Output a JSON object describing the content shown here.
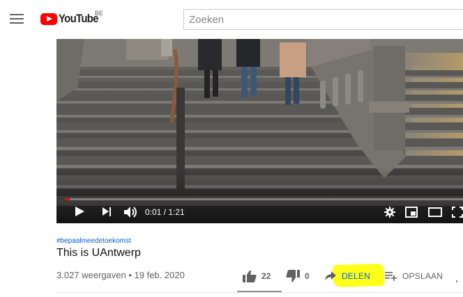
{
  "masthead": {
    "logo_text": "YouTube",
    "country_code": "BE",
    "search_placeholder": "Zoeken"
  },
  "player": {
    "time_display": "0:01 / 1:21",
    "progress_fraction": 0.012
  },
  "video": {
    "hashtag": "#bepaalmeedetoekomst",
    "title": "This is UAntwerp",
    "views_date": "3.027 weergaven • 19 feb. 2020"
  },
  "actions": {
    "likes": "22",
    "dislikes": "0",
    "share_label": "DELEN",
    "save_label": "OPSLAAN",
    "more": "·"
  },
  "colors": {
    "brand_red": "#ff0000",
    "link_blue": "#065fd4",
    "highlight_yellow": "#ffff1a",
    "text_secondary": "#606060"
  },
  "icons": [
    "menu-icon",
    "youtube-logo",
    "play-icon",
    "next-icon",
    "volume-icon",
    "settings-icon",
    "miniplayer-icon",
    "theater-icon",
    "fullscreen-icon",
    "thumb-up-icon",
    "thumb-down-icon",
    "share-icon",
    "save-playlist-icon",
    "more-icon"
  ]
}
